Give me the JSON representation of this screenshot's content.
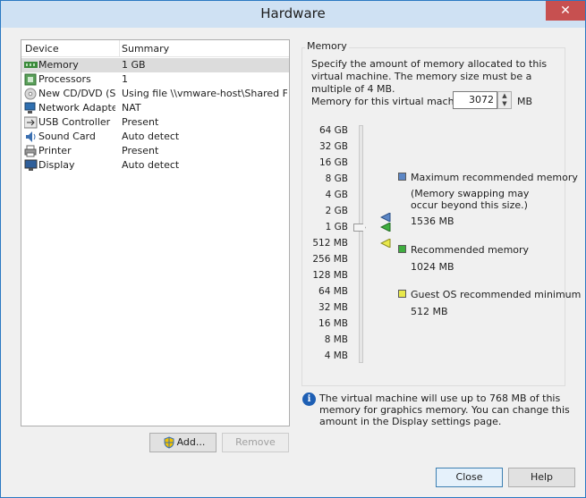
{
  "window": {
    "title": "Hardware",
    "close_glyph": "✕"
  },
  "device_list": {
    "headers": {
      "device": "Device",
      "summary": "Summary"
    },
    "rows": [
      {
        "name": "Memory",
        "summary": "1 GB",
        "icon": "memory-icon",
        "selected": true
      },
      {
        "name": "Processors",
        "summary": "1",
        "icon": "processor-icon"
      },
      {
        "name": "New CD/DVD (S...",
        "summary": "Using file \\\\vmware-host\\Shared Fol...",
        "icon": "cd-dvd-icon"
      },
      {
        "name": "Network Adapter",
        "summary": "NAT",
        "icon": "network-adapter-icon"
      },
      {
        "name": "USB Controller",
        "summary": "Present",
        "icon": "usb-icon"
      },
      {
        "name": "Sound Card",
        "summary": "Auto detect",
        "icon": "sound-card-icon"
      },
      {
        "name": "Printer",
        "summary": "Present",
        "icon": "printer-icon"
      },
      {
        "name": "Display",
        "summary": "Auto detect",
        "icon": "display-icon"
      }
    ]
  },
  "buttons": {
    "add": "Add...",
    "remove": "Remove",
    "close": "Close",
    "help": "Help"
  },
  "memory": {
    "group_title": "Memory",
    "description": "Specify the amount of memory allocated to this virtual machine. The memory size must be a multiple of 4 MB.",
    "field_label": "Memory for this virtual machine:",
    "value": "3072",
    "unit": "MB",
    "scale": [
      "64 GB",
      "32 GB",
      "16 GB",
      "8 GB",
      "4 GB",
      "2 GB",
      "1 GB",
      "512 MB",
      "256 MB",
      "128 MB",
      "64 MB",
      "32 MB",
      "16 MB",
      "8 MB",
      "4 MB"
    ],
    "legend": {
      "max_title": "Maximum recommended memory",
      "max_note_1": "(Memory swapping may",
      "max_note_2": "occur beyond this size.)",
      "max_value": "1536 MB",
      "rec_title": "Recommended memory",
      "rec_value": "1024 MB",
      "guest_title": "Guest OS recommended minimum",
      "guest_value": "512 MB"
    },
    "colors": {
      "max": "#5b86c5",
      "recommended": "#3fae3f",
      "guest_min": "#e8e84a"
    },
    "info": "The virtual machine will use up to 768 MB of this memory for graphics memory. You can change this amount in the Display settings page."
  }
}
